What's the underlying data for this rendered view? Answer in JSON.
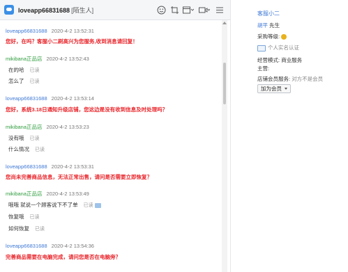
{
  "header": {
    "title": "loveapp66831688",
    "tag": "[陌生人]"
  },
  "messages": [
    {
      "sender": "loveapp66831688",
      "time": "2020-4-2 13:52:31",
      "type": "self",
      "lines": [
        {
          "text": "您好，在吗？客服小二刷高兴为您服务,收到消息请回复！",
          "red": true
        }
      ]
    },
    {
      "sender": "mikibana正品店",
      "time": "2020-4-2 13:52:43",
      "type": "other",
      "lines": [
        {
          "text": "在的哈",
          "read": "已读"
        },
        {
          "text": "怎么了",
          "read": "已读"
        }
      ]
    },
    {
      "sender": "loveapp66831688",
      "time": "2020-4-2 13:53:14",
      "type": "self",
      "lines": [
        {
          "text": "您好，系统3.18日通知升级店铺，您这边是没有收到信息及时处理吗？",
          "red": true
        }
      ]
    },
    {
      "sender": "mikibana正品店",
      "time": "2020-4-2 13:53:23",
      "type": "other",
      "lines": [
        {
          "text": "没有哦",
          "read": "已读"
        },
        {
          "text": "什么情况",
          "read": "已读"
        }
      ]
    },
    {
      "sender": "loveapp66831688",
      "time": "2020-4-2 13:53:31",
      "type": "self",
      "lines": [
        {
          "text": "您尚未完善商品信息，无法正常出售，请问是否需要立即恢复？",
          "red": true
        }
      ]
    },
    {
      "sender": "mikibana正品店",
      "time": "2020-4-2 13:53:49",
      "type": "other",
      "lines": [
        {
          "text": "哦哦 就说一个顾客说下不了单",
          "read": "已读",
          "emoticon": true
        },
        {
          "text": "恢复哦",
          "read": "已读"
        },
        {
          "text": "如何恢复",
          "read": "已读"
        }
      ]
    },
    {
      "sender": "loveapp66831688",
      "time": "2020-4-2 13:54:36",
      "type": "self",
      "lines": [
        {
          "text": "完善商品需要在电脑完成，请问您是否在电脑旁？",
          "red": true
        }
      ]
    }
  ],
  "profile": {
    "name": "客服小二",
    "customer_name": "胡平",
    "customer_title": "先生",
    "level_label": "采购等级:",
    "verify_label": "个人实名认证",
    "business_label": "经营模式:",
    "business_value": "商业服务",
    "main_label": "主营:",
    "membership_label": "店铺会员服务:",
    "membership_value": "对方不是会员",
    "join_button": "加为会员"
  }
}
